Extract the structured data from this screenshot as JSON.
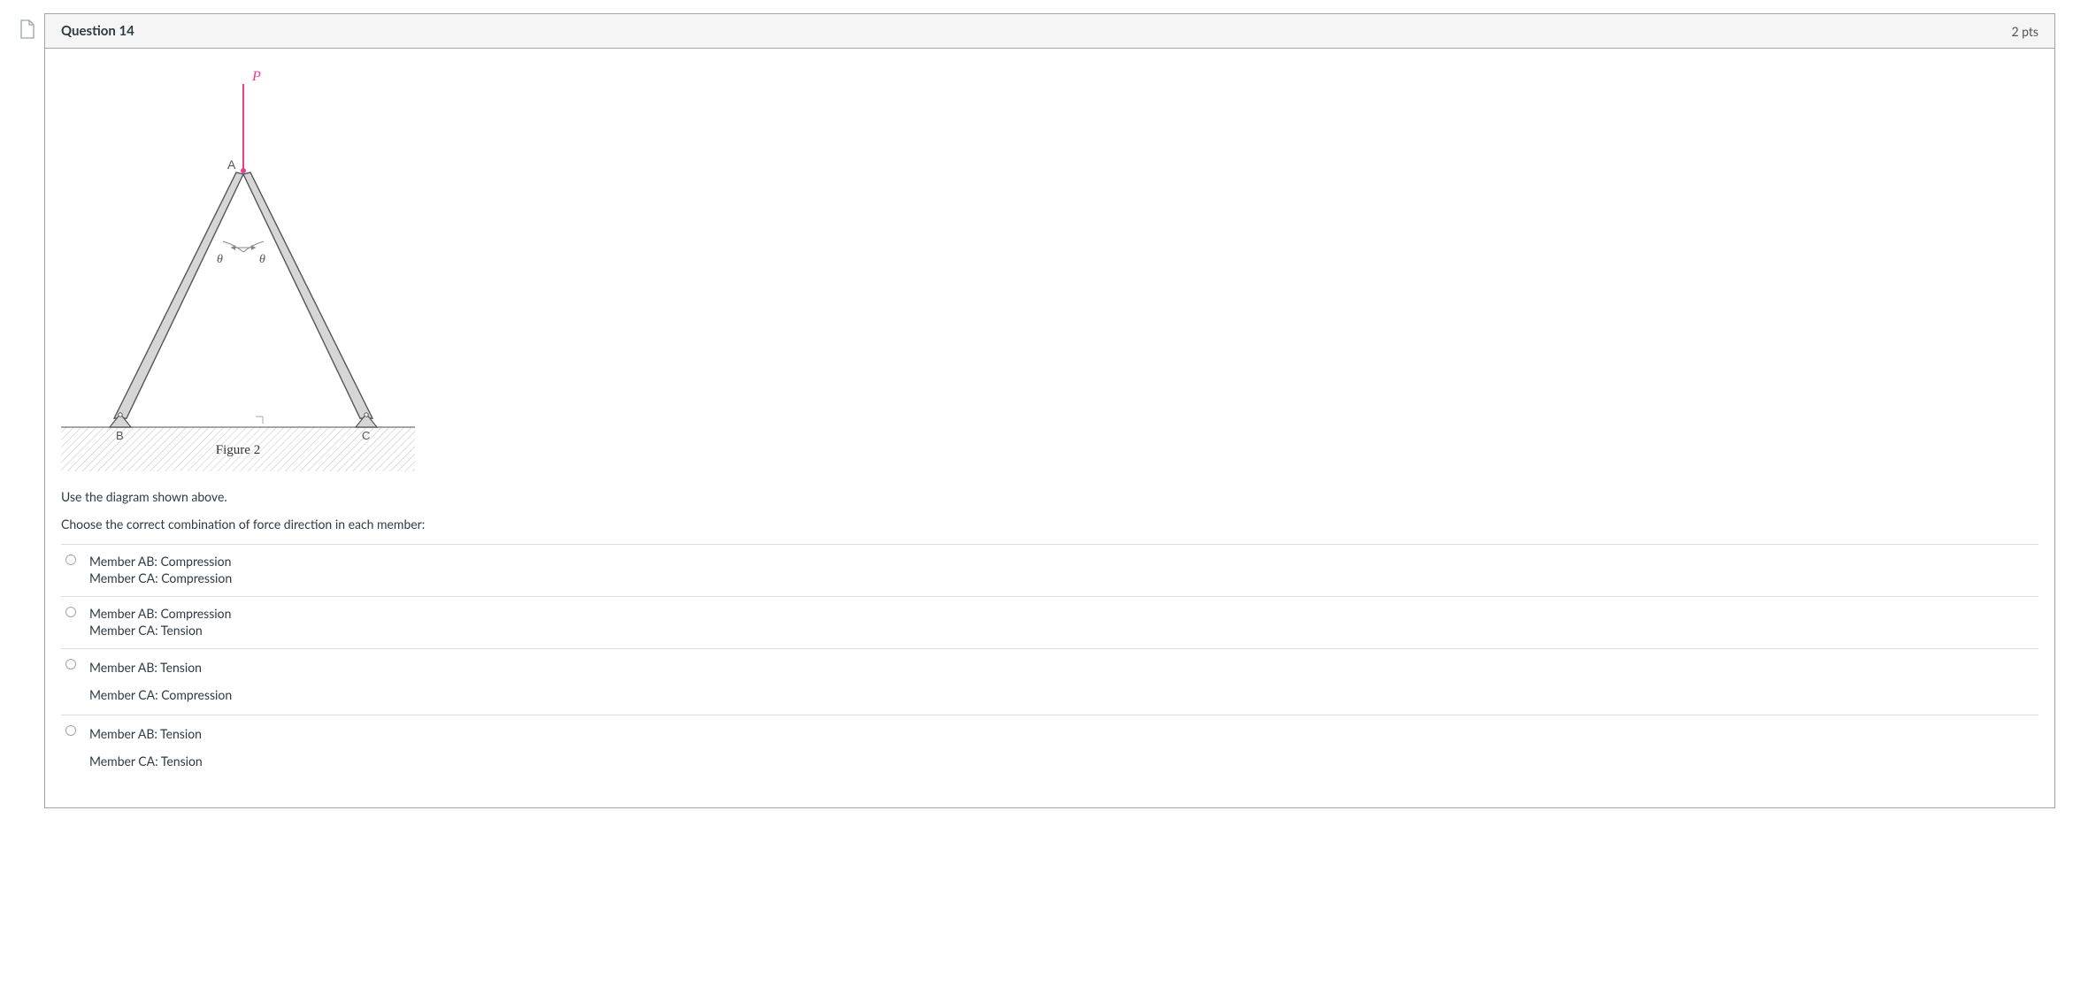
{
  "question": {
    "title": "Question 14",
    "points": "2 pts"
  },
  "figure": {
    "label_P": "P",
    "label_A": "A",
    "label_B": "B",
    "label_C": "C",
    "theta_left": "θ",
    "theta_right": "θ",
    "caption": "Figure 2"
  },
  "prompt": {
    "line1": "Use the diagram shown above.",
    "line2": "Choose the correct combination of force direction in each member:"
  },
  "options": [
    {
      "l1": "Member AB:  Compression",
      "l2": "Member CA:  Compression",
      "tall": false
    },
    {
      "l1": "Member AB:  Compression",
      "l2": "Member CA:  Tension",
      "tall": false
    },
    {
      "l1": "Member AB:  Tension",
      "l2": "Member CA:  Compression",
      "tall": true
    },
    {
      "l1": "Member AB:  Tension",
      "l2": "Member CA:  Tension",
      "tall": true
    }
  ]
}
